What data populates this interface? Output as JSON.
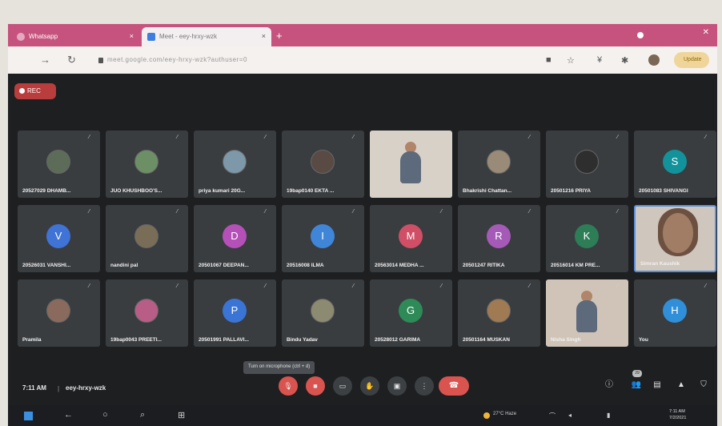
{
  "browser": {
    "tabs": [
      {
        "title": "Whatsapp"
      },
      {
        "title": "Meet - eey-hrxy-wzk"
      }
    ],
    "new_tab": "+",
    "close": "×",
    "url": "meet.google.com/eey-hrxy-wzk?authuser=0",
    "update_label": "Update"
  },
  "meet": {
    "rec_label": "REC",
    "tiles": [
      {
        "name": "20527029 DHAMB...",
        "kind": "photo",
        "color": "#5d6b59"
      },
      {
        "name": "JUO KHUSHBOO'S...",
        "kind": "photo",
        "color": "#6d8f66"
      },
      {
        "name": "priya kumari 20G...",
        "kind": "photo",
        "color": "#7d98a9"
      },
      {
        "name": "19bap0140 EKTA ...",
        "kind": "photo",
        "color": "#5a4a44"
      },
      {
        "name": "",
        "kind": "video",
        "color": "#d8d1c8"
      },
      {
        "name": "Bhakrishi Chattan...",
        "kind": "photo",
        "color": "#9a8a78"
      },
      {
        "name": "20501216 PRIYA",
        "kind": "photo",
        "color": "#2e2e2e"
      },
      {
        "name": "20501083 SHIVANGI",
        "kind": "letter",
        "letter": "S",
        "color": "#12939b"
      },
      {
        "name": "20526031 VANSHI...",
        "kind": "letter",
        "letter": "V",
        "color": "#3f73d6"
      },
      {
        "name": "nandini pal",
        "kind": "photo",
        "color": "#7a6d58"
      },
      {
        "name": "20501067 DEEPAN...",
        "kind": "letter",
        "letter": "D",
        "color": "#b550b8"
      },
      {
        "name": "20516008 ILMA",
        "kind": "letter",
        "letter": "I",
        "color": "#3f86d8"
      },
      {
        "name": "20563014 MEDHA ...",
        "kind": "letter",
        "letter": "M",
        "color": "#d04f66"
      },
      {
        "name": "20501247 RITIKA",
        "kind": "letter",
        "letter": "R",
        "color": "#a55ab7"
      },
      {
        "name": "20516014 KM PRE...",
        "kind": "letter",
        "letter": "K",
        "color": "#2d7d57"
      },
      {
        "name": "Simran Kaushik",
        "kind": "selfcam",
        "color": "#cfc6bd"
      },
      {
        "name": "Pramila",
        "kind": "photo",
        "color": "#8a6a5c"
      },
      {
        "name": "19bap0043 PREETI...",
        "kind": "photo",
        "color": "#b85d86"
      },
      {
        "name": "20501991 PALLAVI...",
        "kind": "letter",
        "letter": "P",
        "color": "#3a74d4"
      },
      {
        "name": "Bindu Yadav",
        "kind": "photo",
        "color": "#8d8a72"
      },
      {
        "name": "20528012 GARIMA",
        "kind": "letter",
        "letter": "G",
        "color": "#2e8b57"
      },
      {
        "name": "20501164 MUSKAN",
        "kind": "photo",
        "color": "#a07a52"
      },
      {
        "name": "Nisha Singh",
        "kind": "video",
        "color": "#d0c4b8"
      },
      {
        "name": "You",
        "kind": "letter",
        "letter": "H",
        "color": "#2f8fd8"
      }
    ],
    "bottom": {
      "time": "7:11 AM",
      "separator": "|",
      "meeting_code": "eey-hrxy-wzk",
      "tooltip": "Turn on microphone (ctrl + d)",
      "participant_count": "29"
    }
  },
  "taskbar": {
    "weather": "27°C Haze",
    "tray_time": "7:11 AM",
    "tray_date": "7/2/2021"
  }
}
